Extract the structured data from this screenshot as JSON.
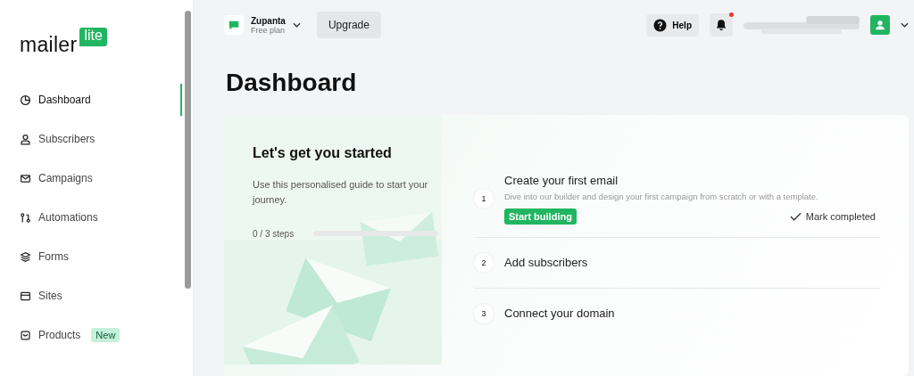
{
  "logo": {
    "text": "mailer",
    "badge": "lite"
  },
  "sidebar": {
    "items": [
      {
        "label": "Dashboard",
        "selected": true
      },
      {
        "label": "Subscribers",
        "selected": false
      },
      {
        "label": "Campaigns",
        "selected": false
      },
      {
        "label": "Automations",
        "selected": false
      },
      {
        "label": "Forms",
        "selected": false
      },
      {
        "label": "Sites",
        "selected": false
      },
      {
        "label": "Products",
        "selected": false,
        "badge": "New"
      }
    ]
  },
  "topbar": {
    "account": {
      "name": "Zupanta",
      "plan": "Free plan"
    },
    "upgrade": "Upgrade",
    "help": "Help",
    "notification": true
  },
  "page": {
    "title": "Dashboard"
  },
  "guide": {
    "title": "Let's get you started",
    "text": "Use this personalised guide to start your journey.",
    "progress_label": "0 / 3 steps",
    "level": 0,
    "steps": [
      {
        "number": "1",
        "title": "Create your first email",
        "description": "Dive into our builder and design your first campaign from scratch or with a template.",
        "action": "Start building",
        "mark": "Mark completed"
      },
      {
        "number": "2",
        "title": "Add subscribers"
      },
      {
        "number": "3",
        "title": "Connect your domain"
      }
    ]
  }
}
